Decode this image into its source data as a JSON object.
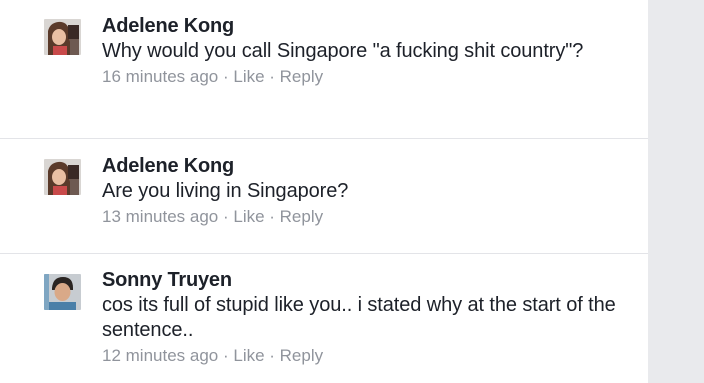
{
  "comments": [
    {
      "author": "Adelene Kong",
      "text": "Why would you call Singapore \"a fucking shit country\"?",
      "time": "16 minutes ago",
      "like_label": "Like",
      "reply_label": "Reply",
      "separator": " · "
    },
    {
      "author": "Adelene Kong",
      "text": "Are you living in Singapore?",
      "time": "13 minutes ago",
      "like_label": "Like",
      "reply_label": "Reply",
      "separator": " · "
    },
    {
      "author": "Sonny Truyen",
      "text": "cos its full of stupid like you.. i stated why at the start of the sentence..",
      "time": "12 minutes ago",
      "like_label": "Like",
      "reply_label": "Reply",
      "separator": " · "
    }
  ],
  "colors": {
    "author": "#1d2129",
    "meta": "#90949c",
    "background": "#ffffff",
    "gutter": "#e9eaed"
  }
}
